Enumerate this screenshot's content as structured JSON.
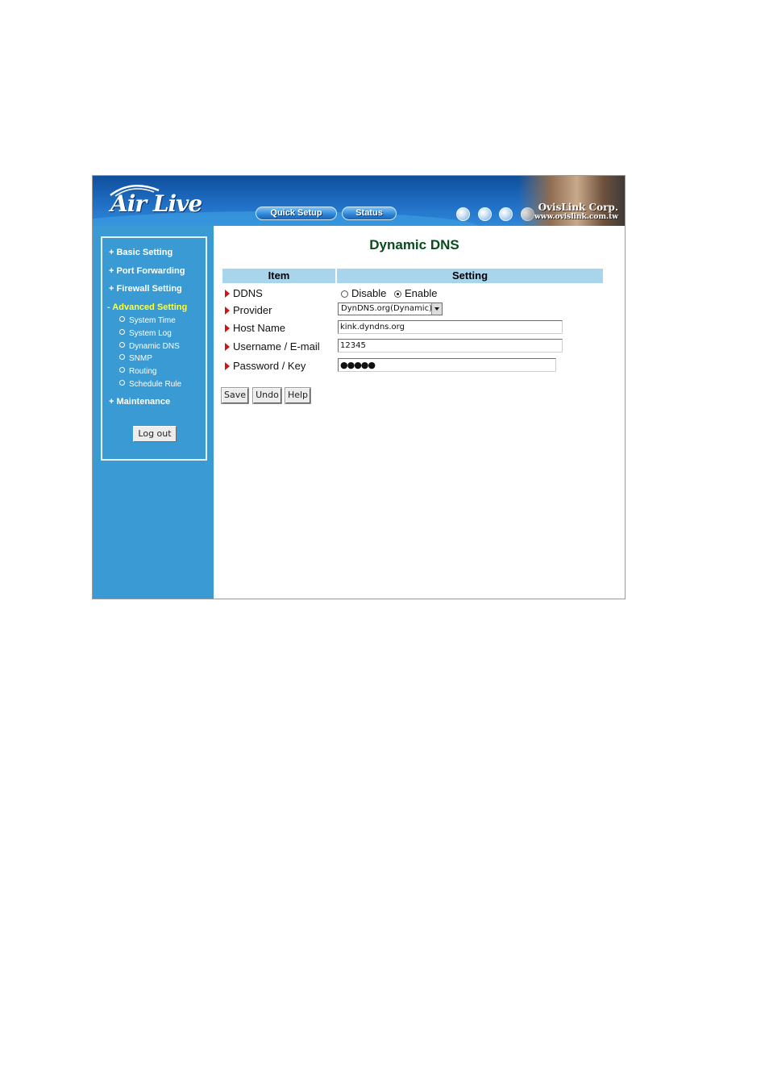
{
  "header": {
    "logo_text": "Air Live",
    "quick_setup_label": "Quick Setup",
    "status_label": "Status",
    "brand_name": "OvisLink Corp.",
    "brand_url": "www.ovislink.com.tw",
    "icons": [
      "globe-icon",
      "globe-icon",
      "globe-icon",
      "globe-icon"
    ]
  },
  "sidebar": {
    "menu": [
      {
        "label": "+ Basic Setting"
      },
      {
        "label": "+ Port Forwarding"
      },
      {
        "label": "+ Firewall Setting"
      },
      {
        "label": "- Advanced Setting",
        "active": true
      },
      {
        "label": "+ Maintenance"
      }
    ],
    "submenu": [
      {
        "label": "System Time"
      },
      {
        "label": "System Log"
      },
      {
        "label": "Dynamic DNS"
      },
      {
        "label": "SNMP"
      },
      {
        "label": "Routing"
      },
      {
        "label": "Schedule Rule"
      }
    ],
    "logout_label": "Log out"
  },
  "main": {
    "title": "Dynamic DNS",
    "table": {
      "headers": [
        "Item",
        "Setting"
      ],
      "rows": [
        {
          "label": "DDNS"
        },
        {
          "label": "Provider"
        },
        {
          "label": "Host Name"
        },
        {
          "label": "Username / E-mail"
        },
        {
          "label": "Password / Key"
        }
      ]
    },
    "ddns": {
      "disable_label": "Disable",
      "enable_label": "Enable",
      "selected": "Enable"
    },
    "provider_value": "DynDNS.org(Dynamic)",
    "host_name_value": "kink.dyndns.org",
    "username_value": "12345",
    "password_value": "●●●●●",
    "buttons": {
      "save": "Save",
      "undo": "Undo",
      "help": "Help"
    }
  },
  "colors": {
    "header_blue": "#1f6ec4",
    "sidebar_blue": "#3a9ad3",
    "active_menu": "#ffff3a",
    "title_green": "#0b4a1e",
    "table_header": "#a8d4ec",
    "bullet_red": "#d01414"
  }
}
